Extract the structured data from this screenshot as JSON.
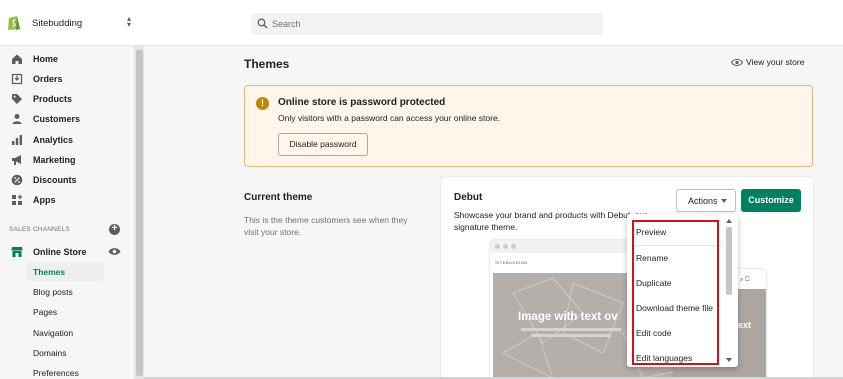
{
  "topbar": {
    "store_name": "Sitebudding",
    "search_placeholder": "Search"
  },
  "sidebar": {
    "items": [
      {
        "label": "Home",
        "icon": "home-icon"
      },
      {
        "label": "Orders",
        "icon": "orders-icon"
      },
      {
        "label": "Products",
        "icon": "tag-icon"
      },
      {
        "label": "Customers",
        "icon": "person-icon"
      },
      {
        "label": "Analytics",
        "icon": "bar-chart-icon"
      },
      {
        "label": "Marketing",
        "icon": "megaphone-icon"
      },
      {
        "label": "Discounts",
        "icon": "discount-icon"
      },
      {
        "label": "Apps",
        "icon": "apps-icon"
      }
    ],
    "sales_channels_heading": "SALES CHANNELS",
    "online_store_label": "Online Store",
    "sub_items": [
      "Themes",
      "Blog posts",
      "Pages",
      "Navigation",
      "Domains",
      "Preferences"
    ],
    "active_sub_item": "Themes"
  },
  "main": {
    "title": "Themes",
    "view_store_label": "View your store",
    "banner": {
      "title": "Online store is password protected",
      "text": "Only visitors with a password can access your online store.",
      "button_label": "Disable password"
    },
    "current_theme": {
      "heading": "Current theme",
      "description": "This is the theme customers see when they visit your store."
    },
    "theme_card": {
      "name": "Debut",
      "description": "Showcase your brand and products with Debut, our signature theme.",
      "actions_label": "Actions",
      "customize_label": "Customize",
      "preview_site_name": "SITEBUDDING",
      "preview_hero_text": "Image with text ov",
      "preview_mobile_text": "text"
    },
    "actions_menu": [
      "Preview",
      "Rename",
      "Duplicate",
      "Download theme file",
      "Edit code",
      "Edit languages"
    ]
  },
  "colors": {
    "accent": "#008060",
    "banner_bg": "#fff5ea",
    "banner_border": "#e1b878",
    "highlight": "#d0131b"
  }
}
